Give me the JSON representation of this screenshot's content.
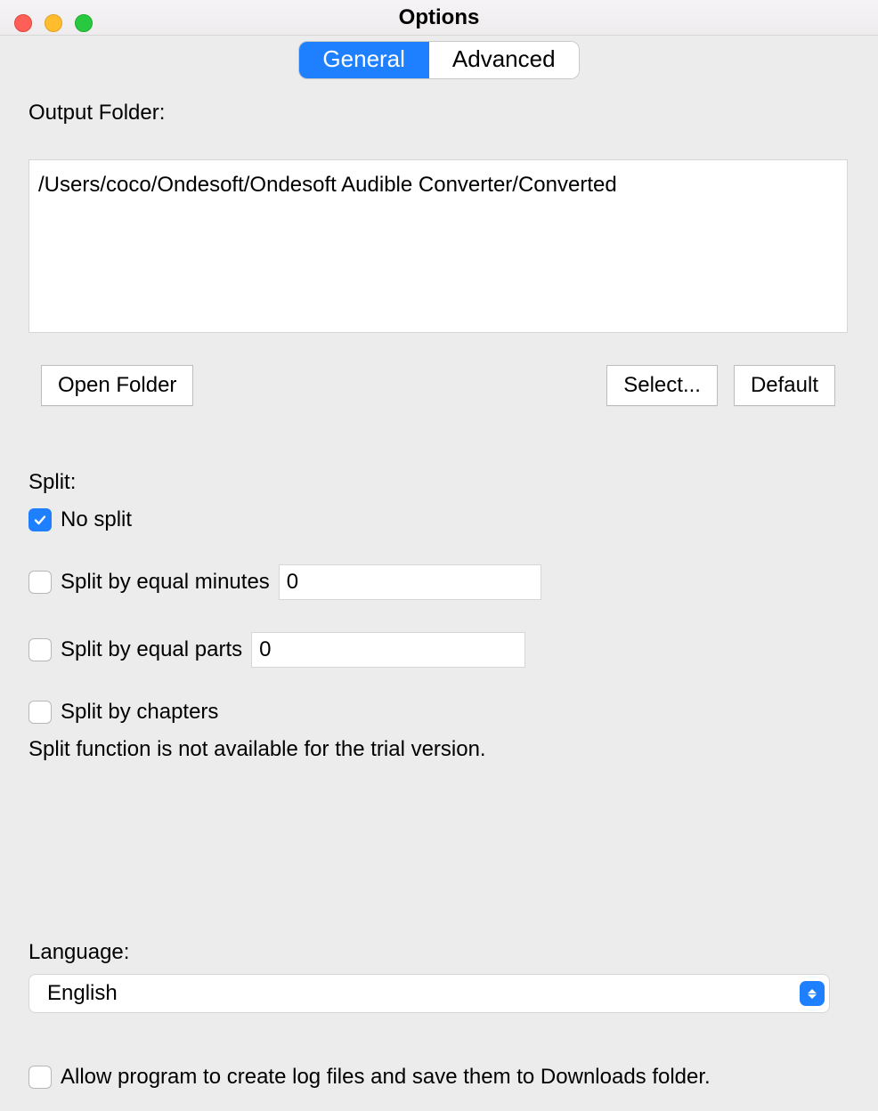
{
  "title": "Options",
  "tabs": {
    "general": "General",
    "advanced": "Advanced"
  },
  "output": {
    "label": "Output Folder:",
    "path": "/Users/coco/Ondesoft/Ondesoft Audible Converter/Converted",
    "open_btn": "Open Folder",
    "select_btn": "Select...",
    "default_btn": "Default"
  },
  "split": {
    "header": "Split:",
    "no_split": "No split",
    "by_minutes": "Split by equal minutes",
    "minutes_value": "0",
    "by_parts": "Split by equal parts",
    "parts_value": "0",
    "by_chapters": "Split by chapters",
    "trial_note": "Split function is not available for the trial version."
  },
  "language": {
    "label": "Language:",
    "value": "English"
  },
  "log": {
    "label": "Allow program to create log files and save them to Downloads folder."
  }
}
